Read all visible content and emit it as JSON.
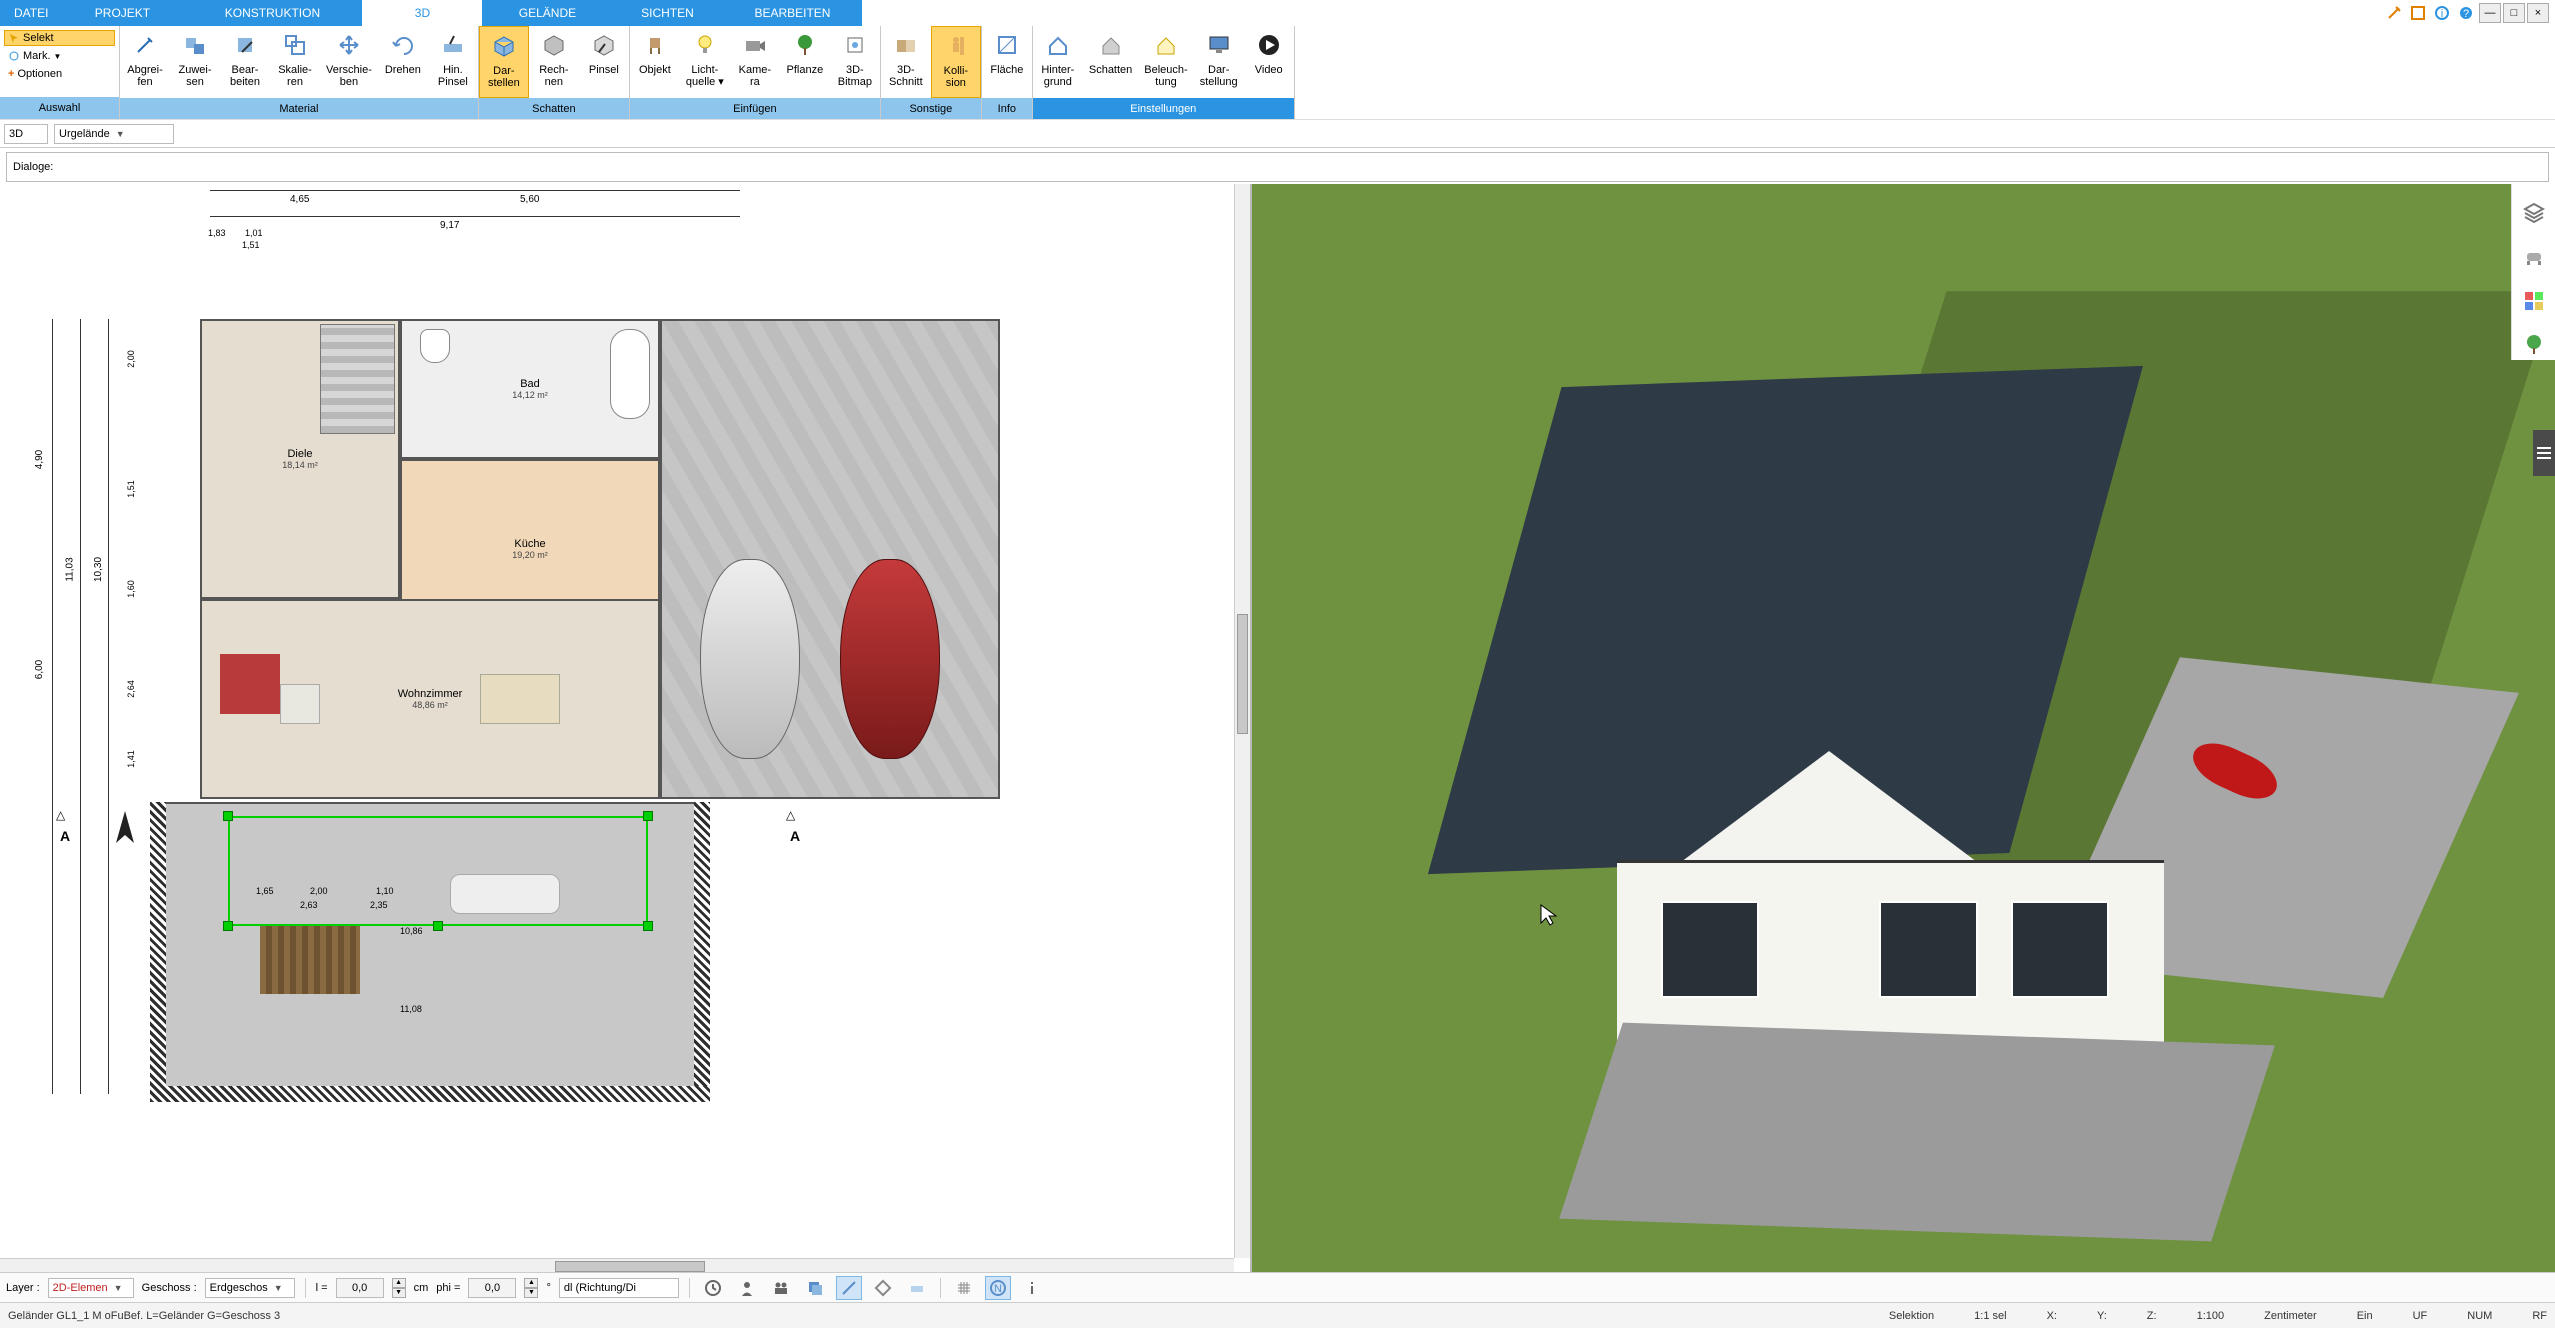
{
  "menu": {
    "tabs": [
      "DATEI",
      "PROJEKT",
      "KONSTRUKTION",
      "3D",
      "GELÄNDE",
      "SICHTEN",
      "BEARBEITEN"
    ],
    "active_index": 3
  },
  "ribbon": {
    "auswahl": {
      "selekt": "Selekt",
      "mark": "Mark.",
      "optionen": "Optionen",
      "group_label": "Auswahl"
    },
    "material": {
      "items": [
        "Abgrei-\nfen",
        "Zuwei-\nsen",
        "Bear-\nbeiten",
        "Skalie-\nren",
        "Verschie-\nben",
        "Drehen",
        "Hin.\nPinsel"
      ],
      "group_label": "Material"
    },
    "schatten": {
      "items": [
        "Dar-\nstellen",
        "Rech-\nnen",
        "Pinsel"
      ],
      "group_label": "Schatten",
      "active_index": 0
    },
    "einfuegen": {
      "items": [
        "Objekt",
        "Licht-\nquelle ▾",
        "Kame-\nra",
        "3D-\nBitmap",
        "Pflanze"
      ],
      "group_label": "Einfügen"
    },
    "sonstige": {
      "items": [
        "3D-\nSchnitt",
        "Kolli-\nsion"
      ],
      "group_label": "Sonstige",
      "active_index": 1
    },
    "info": {
      "items": [
        "Fläche"
      ],
      "group_label": "Info"
    },
    "einstellungen": {
      "items": [
        "Hinter-\ngrund",
        "Schatten",
        "Beleuch-\ntung",
        "Dar-\nstellung",
        "Video"
      ],
      "group_label": "Einstellungen"
    }
  },
  "viewbar": {
    "mode": "3D",
    "layer": "Urgelände"
  },
  "dialog_label": "Dialoge:",
  "plan": {
    "dim_top_left": "4,65",
    "dim_top_right": "5,60",
    "dim_span": "9,17",
    "dim_small1": "1,01",
    "dim_small2": "1,51",
    "dim_small3": "1,83",
    "dim_left1": "4,90",
    "dim_left2": "6,00",
    "dim_left_total": "11,03",
    "dim_left_sub": "10,30",
    "dim_r1": "2,00",
    "dim_r2": "1,51",
    "dim_r3": "1,60",
    "dim_r4": "2,64",
    "dim_r5": "1,41",
    "rooms": {
      "diele": {
        "name": "Diele",
        "area": "18,14 m²"
      },
      "bad": {
        "name": "Bad",
        "area": "14,12 m²"
      },
      "kueche": {
        "name": "Küche",
        "area": "19,20 m²"
      },
      "wohn": {
        "name": "Wohnzimmer",
        "area": "48,86 m²"
      }
    },
    "terrace_dims": {
      "a": "1,65",
      "b": "2,00",
      "c": "1,10",
      "d": "2,63",
      "e": "2,35",
      "f": "10,86",
      "g": "11,08"
    },
    "section_marks": "A"
  },
  "bottom": {
    "layer_label": "Layer :",
    "layer_value": "2D-Elemen",
    "geschoss_label": "Geschoss :",
    "geschoss_value": "Erdgeschos",
    "l_label": "l =",
    "l_value": "0,0",
    "l_unit": "cm",
    "phi_label": "phi =",
    "phi_value": "0,0",
    "phi_unit": "°",
    "dl_value": "dl (Richtung/Di"
  },
  "status": {
    "left": "Geländer GL1_1 M oFuBef. L=Geländer G=Geschoss 3",
    "selektion": "Selektion",
    "ratio": "1:1 sel",
    "x": "X:",
    "y": "Y:",
    "z": "Z:",
    "scale": "1:100",
    "unit": "Zentimeter",
    "ein": "Ein",
    "uf": "UF",
    "num": "NUM",
    "rf": "RF"
  }
}
